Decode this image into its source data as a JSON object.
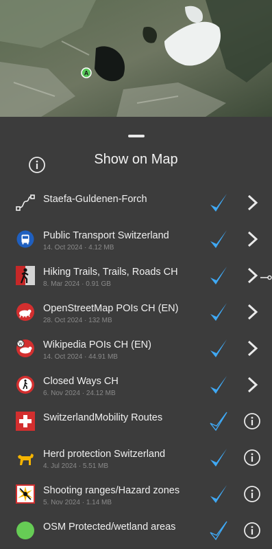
{
  "colors": {
    "accent": "#3fa9f5",
    "background": "#3c3c3c",
    "text": "#f0f0f0",
    "meta": "#8a8a8a"
  },
  "map": {
    "marker_label": "A"
  },
  "sheet": {
    "title": "Show on Map",
    "info_icon": "info-icon"
  },
  "layers": [
    {
      "name": "Staefa-Guldenen-Forch",
      "meta": "",
      "icon": "route-icon",
      "checked": true,
      "check_style": "solid",
      "action": "chevron-right-icon"
    },
    {
      "name": "Public Transport Switzerland",
      "meta": "14. Oct 2024 · 4.12 MB",
      "icon": "bus-icon",
      "checked": true,
      "check_style": "solid",
      "action": "chevron-right-icon"
    },
    {
      "name": "Hiking Trails, Trails, Roads CH",
      "meta": "8. Mar 2024 · 0.91 GB",
      "icon": "hiker-icon",
      "checked": true,
      "check_style": "solid",
      "action": "chevron-right-icon"
    },
    {
      "name": "OpenStreetMap POIs CH (EN)",
      "meta": "28. Oct 2024 · 132 MB",
      "icon": "osm-poi-icon",
      "checked": true,
      "check_style": "solid",
      "action": "chevron-right-icon"
    },
    {
      "name": "Wikipedia POIs CH (EN)",
      "meta": "14. Oct 2024 · 44.91 MB",
      "icon": "wikipedia-poi-icon",
      "checked": true,
      "check_style": "solid",
      "action": "chevron-right-icon"
    },
    {
      "name": "Closed Ways CH",
      "meta": "6. Nov 2024 · 24.12 MB",
      "icon": "no-pedestrian-icon",
      "checked": true,
      "check_style": "solid",
      "action": "chevron-right-icon"
    },
    {
      "name": "SwitzerlandMobility Routes",
      "meta": "",
      "icon": "swiss-cross-icon",
      "checked": true,
      "check_style": "outline",
      "action": "info-icon"
    },
    {
      "name": "Herd protection Switzerland",
      "meta": "4. Jul 2024 · 5.51 MB",
      "icon": "herd-dog-icon",
      "checked": true,
      "check_style": "solid",
      "action": "info-icon"
    },
    {
      "name": "Shooting ranges/Hazard zones",
      "meta": "5. Nov 2024 · 1.14 MB",
      "icon": "hazard-icon",
      "checked": true,
      "check_style": "solid",
      "action": "info-icon"
    },
    {
      "name": "OSM Protected/wetland areas",
      "meta": "",
      "icon": "protected-area-icon",
      "checked": true,
      "check_style": "outline",
      "action": "info-icon"
    }
  ]
}
